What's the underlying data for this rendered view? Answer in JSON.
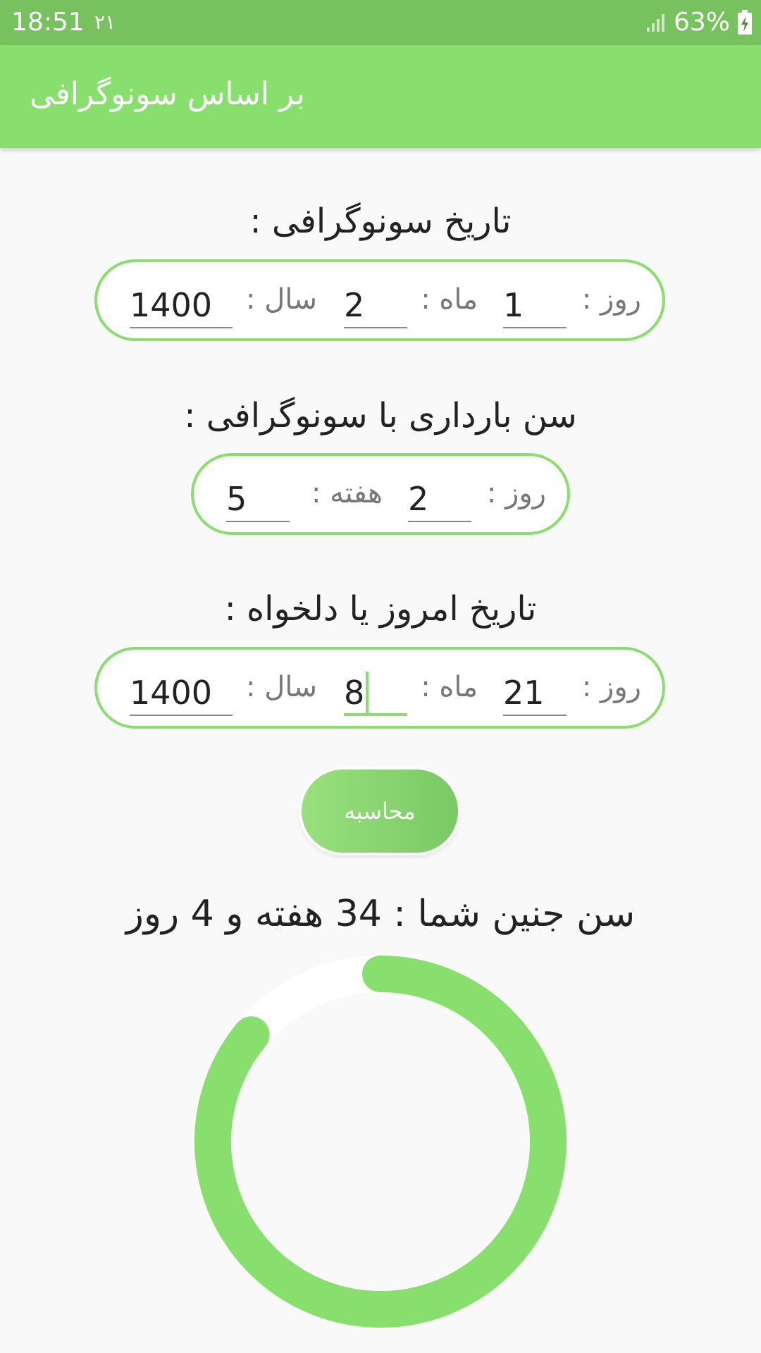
{
  "status_bar": {
    "time": "18:51",
    "date": "۲۱",
    "battery_percent": "63%"
  },
  "app_bar": {
    "title": "بر اساس سونوگرافی"
  },
  "sonography_date": {
    "title": "تاریخ سونوگرافی :",
    "day_label": "روز :",
    "day_value": "1",
    "month_label": "ماه :",
    "month_value": "2",
    "year_label": "سال :",
    "year_value": "1400"
  },
  "gestational_age_at_sonography": {
    "title": "سن بارداری با سونوگرافی :",
    "day_label": "روز :",
    "day_value": "2",
    "week_label": "هفته :",
    "week_value": "5"
  },
  "target_date": {
    "title": "تاریخ امروز یا دلخواه :",
    "day_label": "روز :",
    "day_value": "21",
    "month_label": "ماه :",
    "month_value": "8",
    "year_label": "سال :",
    "year_value": "1400"
  },
  "calculate_button": {
    "label": "محاسبه"
  },
  "result": {
    "text": "سن جنین شما : 34 هفته و 4 روز"
  },
  "progress": {
    "fraction": 0.86,
    "color": "#88df6e",
    "track_color": "#ffffff"
  },
  "colors": {
    "status_bar": "#77c15f",
    "app_bar": "#88df6e",
    "accent": "#88df6e"
  }
}
